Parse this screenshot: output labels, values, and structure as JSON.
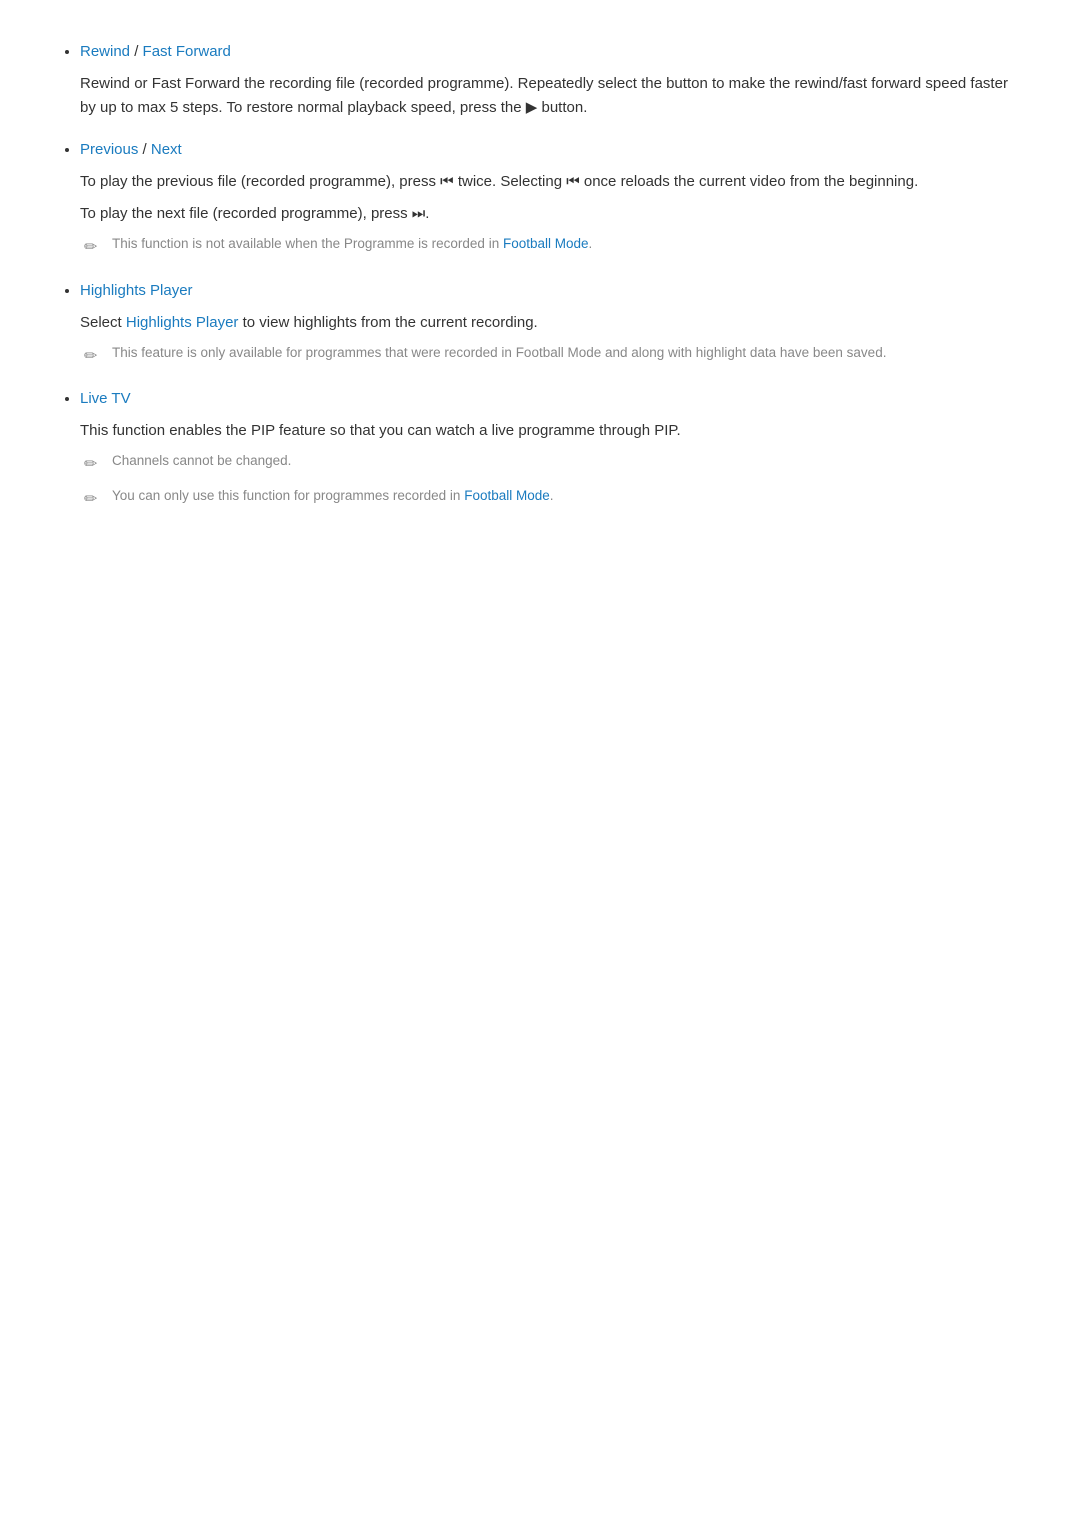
{
  "sections": [
    {
      "id": "rewind-fast-forward",
      "title_parts": [
        {
          "text": "Rewind",
          "link": true
        },
        {
          "text": " / ",
          "link": false
        },
        {
          "text": "Fast Forward",
          "link": true
        }
      ],
      "body": [
        {
          "type": "paragraph",
          "text": "Rewind or Fast Forward the recording file (recorded programme). Repeatedly select the button to make the rewind/fast forward speed faster by up to max 5 steps. To restore normal playback speed, press the ▶ button."
        }
      ],
      "notes": []
    },
    {
      "id": "previous-next",
      "title_parts": [
        {
          "text": "Previous",
          "link": true
        },
        {
          "text": " / ",
          "link": false
        },
        {
          "text": "Next",
          "link": true
        }
      ],
      "body": [
        {
          "type": "paragraph",
          "text": "To play the previous file (recorded programme), press ⏮ twice. Selecting ⏮ once reloads the current video from the beginning."
        },
        {
          "type": "paragraph",
          "text": "To play the next file (recorded programme), press ⏭."
        }
      ],
      "notes": [
        {
          "text_parts": [
            {
              "text": "This function is not available when the Programme is recorded in ",
              "link": false
            },
            {
              "text": "Football Mode",
              "link": true
            },
            {
              "text": ".",
              "link": false
            }
          ]
        }
      ]
    },
    {
      "id": "highlights-player",
      "title_parts": [
        {
          "text": "Highlights Player",
          "link": true
        }
      ],
      "body": [
        {
          "type": "paragraph",
          "text_parts": [
            {
              "text": "Select ",
              "link": false
            },
            {
              "text": "Highlights Player",
              "link": true
            },
            {
              "text": " to view highlights from the current recording.",
              "link": false
            }
          ]
        }
      ],
      "notes": [
        {
          "text_parts": [
            {
              "text": "This feature is only available for programmes that were recorded in Football Mode and along with highlight data have been saved.",
              "link": false
            }
          ]
        }
      ]
    },
    {
      "id": "live-tv",
      "title_parts": [
        {
          "text": "Live TV",
          "link": true
        }
      ],
      "body": [
        {
          "type": "paragraph",
          "text": "This function enables the PIP feature so that you can watch a live programme through PIP."
        }
      ],
      "notes": [
        {
          "text_parts": [
            {
              "text": "Channels cannot be changed.",
              "link": false
            }
          ]
        },
        {
          "text_parts": [
            {
              "text": "You can only use this function for programmes recorded in ",
              "link": false
            },
            {
              "text": "Football Mode",
              "link": true
            },
            {
              "text": ".",
              "link": false
            }
          ]
        }
      ]
    }
  ]
}
